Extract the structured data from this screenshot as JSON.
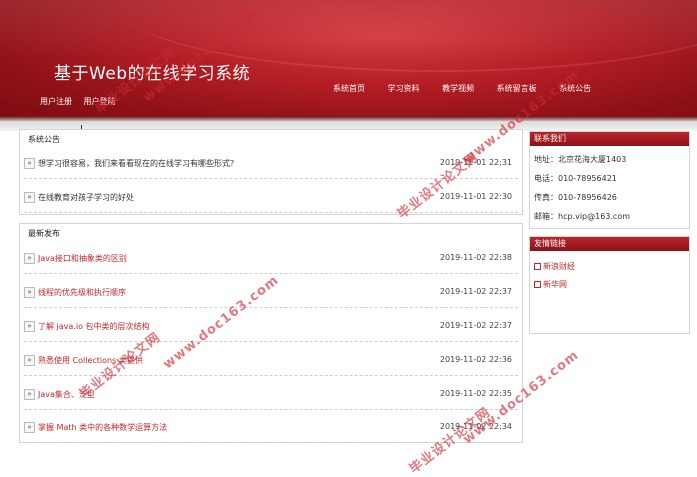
{
  "header": {
    "title": "基于Web的在线学习系统",
    "user_links": [
      "用户注册",
      "用户登陆"
    ],
    "nav": [
      "系统首页",
      "学习资料",
      "教学视频",
      "系统留言板",
      "系统公告"
    ]
  },
  "announcements": {
    "title": "系统公告",
    "items": [
      {
        "text": "想学习很容易，我们来看看现在的在线学习有哪些形式？",
        "date": "2019-11-01 22:31"
      },
      {
        "text": "在线教育对孩子学习的好处",
        "date": "2019-11-01 22:30"
      }
    ]
  },
  "latest": {
    "title": "最新发布",
    "items": [
      {
        "text": "Java接口和抽象类的区别",
        "date": "2019-11-02 22:38"
      },
      {
        "text": "线程的优先级和执行顺序",
        "date": "2019-11-02 22:37"
      },
      {
        "text": "了解 java.io 包中类的层次结构",
        "date": "2019-11-02 22:37"
      },
      {
        "text": "熟悉使用 Collections 类提供",
        "date": "2019-11-02 22:36"
      },
      {
        "text": "Java集合、泛型",
        "date": "2019-11-02 22:35"
      },
      {
        "text": "掌握 Math 类中的各种数学运算方法",
        "date": "2019-11-02 22:34"
      }
    ]
  },
  "contact": {
    "title": "联系我们",
    "address": "地址：北京花海大厦1403",
    "phone": "电话：010-78956421",
    "fax": "传真：010-78956426",
    "email": "邮箱：hcp.vip@163.com"
  },
  "links": {
    "title": "友情链接",
    "items": [
      "新浪财经",
      "新华网"
    ]
  },
  "watermarks": {
    "cn": "毕业设计论文网",
    "url": "www.doc163.com"
  }
}
